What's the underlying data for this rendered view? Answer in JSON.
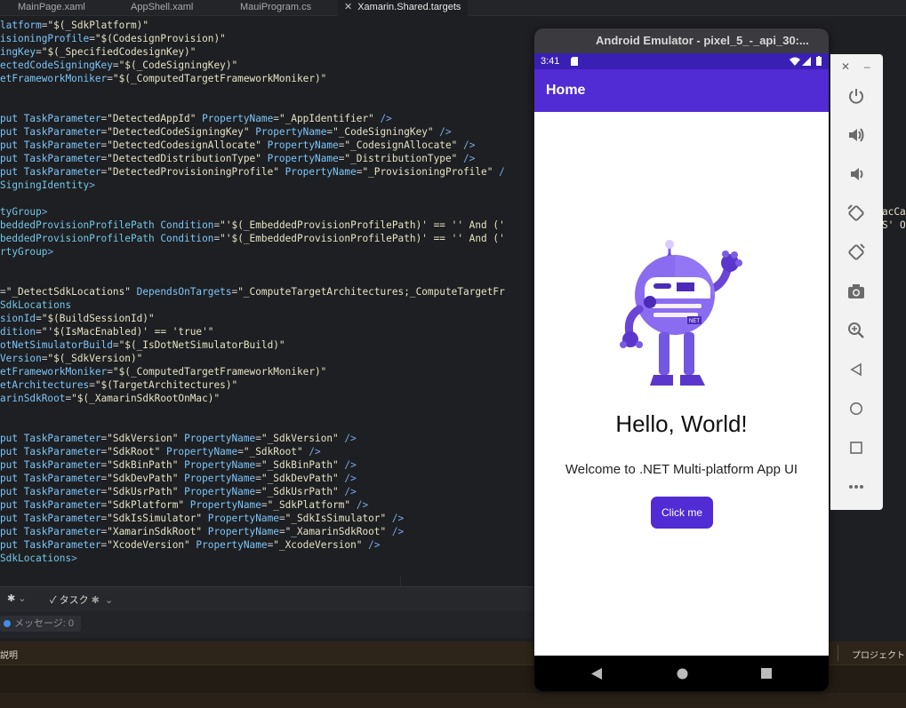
{
  "tabs": [
    {
      "label": "MainPage.xaml",
      "active": false
    },
    {
      "label": "AppShell.xaml",
      "active": false
    },
    {
      "label": "MauiProgram.cs",
      "active": false
    },
    {
      "label": "Xamarin.Shared.targets",
      "active": true
    }
  ],
  "code_lines": [
    [
      [
        "attr",
        "latform"
      ],
      [
        "txt",
        "="
      ],
      [
        "str",
        "\"$(_SdkPlatform)\""
      ]
    ],
    [
      [
        "attr",
        "isioningProfile"
      ],
      [
        "txt",
        "="
      ],
      [
        "str",
        "\"$(CodesignProvision)\""
      ]
    ],
    [
      [
        "attr",
        "ingKey"
      ],
      [
        "txt",
        "="
      ],
      [
        "str",
        "\"$(_SpecifiedCodesignKey)\""
      ]
    ],
    [
      [
        "attr",
        "ectedCodeSigningKey"
      ],
      [
        "txt",
        "="
      ],
      [
        "str",
        "\"$(_CodeSigningKey)\""
      ]
    ],
    [
      [
        "attr",
        "etFrameworkMoniker"
      ],
      [
        "txt",
        "="
      ],
      [
        "str",
        "\"$(_ComputedTargetFrameworkMoniker)\""
      ]
    ],
    [],
    [],
    [
      [
        "attr",
        "put "
      ],
      [
        "attr",
        "TaskParameter"
      ],
      [
        "txt",
        "="
      ],
      [
        "str",
        "\"DetectedAppId\" "
      ],
      [
        "attr",
        "PropertyName"
      ],
      [
        "txt",
        "="
      ],
      [
        "str",
        "\"_AppIdentifier\" "
      ],
      [
        "tag",
        "/>"
      ]
    ],
    [
      [
        "attr",
        "put "
      ],
      [
        "attr",
        "TaskParameter"
      ],
      [
        "txt",
        "="
      ],
      [
        "str",
        "\"DetectedCodeSigningKey\" "
      ],
      [
        "attr",
        "PropertyName"
      ],
      [
        "txt",
        "="
      ],
      [
        "str",
        "\"_CodeSigningKey\" "
      ],
      [
        "tag",
        "/>"
      ]
    ],
    [
      [
        "attr",
        "put "
      ],
      [
        "attr",
        "TaskParameter"
      ],
      [
        "txt",
        "="
      ],
      [
        "str",
        "\"DetectedCodesignAllocate\" "
      ],
      [
        "attr",
        "PropertyName"
      ],
      [
        "txt",
        "="
      ],
      [
        "str",
        "\"_CodesignAllocate\" "
      ],
      [
        "tag",
        "/>"
      ]
    ],
    [
      [
        "attr",
        "put "
      ],
      [
        "attr",
        "TaskParameter"
      ],
      [
        "txt",
        "="
      ],
      [
        "str",
        "\"DetectedDistributionType\" "
      ],
      [
        "attr",
        "PropertyName"
      ],
      [
        "txt",
        "="
      ],
      [
        "str",
        "\"_DistributionType\" "
      ],
      [
        "tag",
        "/>"
      ]
    ],
    [
      [
        "attr",
        "put "
      ],
      [
        "attr",
        "TaskParameter"
      ],
      [
        "txt",
        "="
      ],
      [
        "str",
        "\"DetectedProvisioningProfile\" "
      ],
      [
        "attr",
        "PropertyName"
      ],
      [
        "txt",
        "="
      ],
      [
        "str",
        "\"_ProvisioningProfile\" "
      ],
      [
        "tag",
        "/"
      ]
    ],
    [
      [
        "elem",
        "SigningIdentity"
      ],
      [
        "tag",
        ">"
      ]
    ],
    [],
    [
      [
        "elem",
        "tyGroup"
      ],
      [
        "tag",
        ">"
      ]
    ],
    [
      [
        "elem",
        "beddedProvisionProfilePath "
      ],
      [
        "attr",
        "Condition"
      ],
      [
        "txt",
        "="
      ],
      [
        "str",
        "\"'$(_EmbeddedProvisionProfilePath)' == '' And ('"
      ]
    ],
    [
      [
        "elem",
        "beddedProvisionProfilePath "
      ],
      [
        "attr",
        "Condition"
      ],
      [
        "txt",
        "="
      ],
      [
        "str",
        "\"'$(_EmbeddedProvisionProfilePath)' == '' And ('"
      ]
    ],
    [
      [
        "elem",
        "rtyGroup"
      ],
      [
        "tag",
        ">"
      ]
    ],
    [],
    [],
    [
      [
        "txt",
        "="
      ],
      [
        "str",
        "\"_DetectSdkLocations\" "
      ],
      [
        "attr",
        "DependsOnTargets"
      ],
      [
        "txt",
        "="
      ],
      [
        "str",
        "\"_ComputeTargetArchitectures;_ComputeTargetFr"
      ]
    ],
    [
      [
        "elem",
        "SdkLocations"
      ]
    ],
    [
      [
        "attr",
        "sionId"
      ],
      [
        "txt",
        "="
      ],
      [
        "str",
        "\"$(BuildSessionId)\""
      ]
    ],
    [
      [
        "attr",
        "dition"
      ],
      [
        "txt",
        "="
      ],
      [
        "str",
        "\"'$(IsMacEnabled)' == 'true'\""
      ]
    ],
    [
      [
        "attr",
        "otNetSimulatorBuild"
      ],
      [
        "txt",
        "="
      ],
      [
        "str",
        "\"$(_IsDotNetSimulatorBuild)\""
      ]
    ],
    [
      [
        "attr",
        "Version"
      ],
      [
        "txt",
        "="
      ],
      [
        "str",
        "\"$(_SdkVersion)\""
      ]
    ],
    [
      [
        "attr",
        "etFrameworkMoniker"
      ],
      [
        "txt",
        "="
      ],
      [
        "str",
        "\"$(_ComputedTargetFrameworkMoniker)\""
      ]
    ],
    [
      [
        "attr",
        "etArchitectures"
      ],
      [
        "txt",
        "="
      ],
      [
        "str",
        "\"$(TargetArchitectures)\""
      ]
    ],
    [
      [
        "attr",
        "arinSdkRoot"
      ],
      [
        "txt",
        "="
      ],
      [
        "str",
        "\"$(_XamarinSdkRootOnMac)\""
      ]
    ],
    [],
    [],
    [
      [
        "attr",
        "put "
      ],
      [
        "attr",
        "TaskParameter"
      ],
      [
        "txt",
        "="
      ],
      [
        "str",
        "\"SdkVersion\" "
      ],
      [
        "attr",
        "PropertyName"
      ],
      [
        "txt",
        "="
      ],
      [
        "str",
        "\"_SdkVersion\" "
      ],
      [
        "tag",
        "/>"
      ]
    ],
    [
      [
        "attr",
        "put "
      ],
      [
        "attr",
        "TaskParameter"
      ],
      [
        "txt",
        "="
      ],
      [
        "str",
        "\"SdkRoot\" "
      ],
      [
        "attr",
        "PropertyName"
      ],
      [
        "txt",
        "="
      ],
      [
        "str",
        "\"_SdkRoot\" "
      ],
      [
        "tag",
        "/>"
      ]
    ],
    [
      [
        "attr",
        "put "
      ],
      [
        "attr",
        "TaskParameter"
      ],
      [
        "txt",
        "="
      ],
      [
        "str",
        "\"SdkBinPath\" "
      ],
      [
        "attr",
        "PropertyName"
      ],
      [
        "txt",
        "="
      ],
      [
        "str",
        "\"_SdkBinPath\" "
      ],
      [
        "tag",
        "/>"
      ]
    ],
    [
      [
        "attr",
        "put "
      ],
      [
        "attr",
        "TaskParameter"
      ],
      [
        "txt",
        "="
      ],
      [
        "str",
        "\"SdkDevPath\" "
      ],
      [
        "attr",
        "PropertyName"
      ],
      [
        "txt",
        "="
      ],
      [
        "str",
        "\"_SdkDevPath\" "
      ],
      [
        "tag",
        "/>"
      ]
    ],
    [
      [
        "attr",
        "put "
      ],
      [
        "attr",
        "TaskParameter"
      ],
      [
        "txt",
        "="
      ],
      [
        "str",
        "\"SdkUsrPath\" "
      ],
      [
        "attr",
        "PropertyName"
      ],
      [
        "txt",
        "="
      ],
      [
        "str",
        "\"_SdkUsrPath\" "
      ],
      [
        "tag",
        "/>"
      ]
    ],
    [
      [
        "attr",
        "put "
      ],
      [
        "attr",
        "TaskParameter"
      ],
      [
        "txt",
        "="
      ],
      [
        "str",
        "\"SdkPlatform\" "
      ],
      [
        "attr",
        "PropertyName"
      ],
      [
        "txt",
        "="
      ],
      [
        "str",
        "\"_SdkPlatform\" "
      ],
      [
        "tag",
        "/>"
      ]
    ],
    [
      [
        "attr",
        "put "
      ],
      [
        "attr",
        "TaskParameter"
      ],
      [
        "txt",
        "="
      ],
      [
        "str",
        "\"SdkIsSimulator\" "
      ],
      [
        "attr",
        "PropertyName"
      ],
      [
        "txt",
        "="
      ],
      [
        "str",
        "\"_SdkIsSimulator\" "
      ],
      [
        "tag",
        "/>"
      ]
    ],
    [
      [
        "attr",
        "put "
      ],
      [
        "attr",
        "TaskParameter"
      ],
      [
        "txt",
        "="
      ],
      [
        "str",
        "\"XamarinSdkRoot\" "
      ],
      [
        "attr",
        "PropertyName"
      ],
      [
        "txt",
        "="
      ],
      [
        "str",
        "\"_XamarinSdkRoot\" "
      ],
      [
        "tag",
        "/>"
      ]
    ],
    [
      [
        "attr",
        "put "
      ],
      [
        "attr",
        "TaskParameter"
      ],
      [
        "txt",
        "="
      ],
      [
        "str",
        "\"XcodeVersion\" "
      ],
      [
        "attr",
        "PropertyName"
      ],
      [
        "txt",
        "="
      ],
      [
        "str",
        "\"_XcodeVersion\" "
      ],
      [
        "tag",
        "/>"
      ]
    ],
    [
      [
        "elem",
        "SdkLocations"
      ],
      [
        "tag",
        ">"
      ]
    ]
  ],
  "code_overflow": [
    {
      "line": 15,
      "text": "acCa"
    },
    {
      "line": 16,
      "text": "S' O"
    }
  ],
  "bottom_panel": {
    "tasks_label": "タスク",
    "messages_label": "メッセージ: 0",
    "description_header": "説明",
    "project_header": "プロジェクト"
  },
  "emulator": {
    "window_title": "Android Emulator - pixel_5_-_api_30:...",
    "status_time": "3:41",
    "app_title": "Home",
    "hello_text": "Hello, World!",
    "welcome_text": "Welcome to .NET Multi-platform App UI",
    "button_label": "Click me",
    "bot_badge": "NET"
  },
  "emulator_toolbar": {
    "items": [
      "power-icon",
      "volume-up-icon",
      "volume-down-icon",
      "rotate-left-icon",
      "rotate-right-icon",
      "camera-icon",
      "zoom-icon",
      "back-icon",
      "home-icon",
      "overview-icon",
      "more-icon"
    ]
  },
  "colors": {
    "maui_purple": "#512bd4",
    "status_bar": "#3a1fb5",
    "editor_bg": "#1e1f22"
  }
}
